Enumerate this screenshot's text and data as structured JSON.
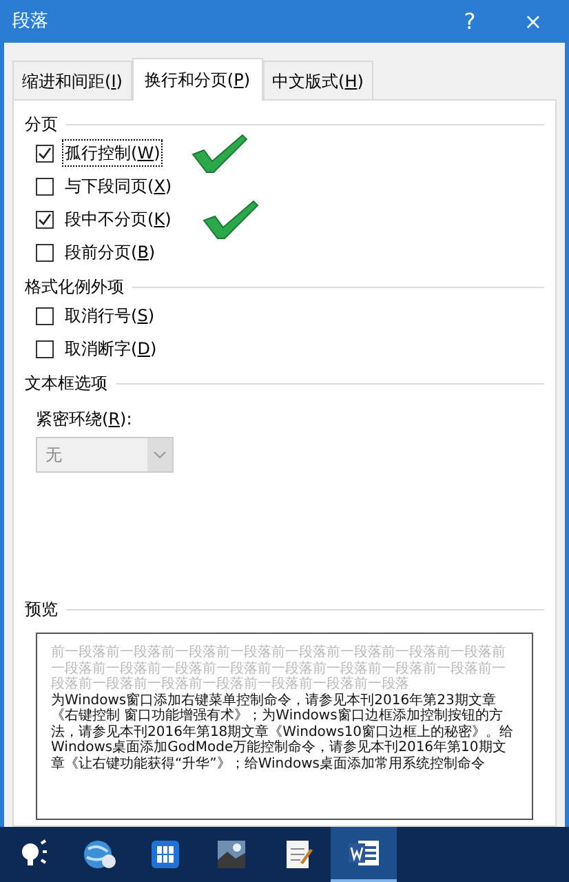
{
  "window": {
    "title": "段落",
    "help": "?",
    "close": "×"
  },
  "tabs": [
    {
      "label": "缩进和间距(I)",
      "selected": false
    },
    {
      "label": "换行和分页(P)",
      "selected": true
    },
    {
      "label": "中文版式(H)",
      "selected": false
    }
  ],
  "groups": [
    {
      "title": "分页",
      "options": [
        {
          "label": "孤行控制(W)",
          "checked": true,
          "focused": true,
          "annotated": true
        },
        {
          "label": "与下段同页(X)",
          "checked": false,
          "focused": false,
          "annotated": false
        },
        {
          "label": "段中不分页(K)",
          "checked": true,
          "focused": false,
          "annotated": true
        },
        {
          "label": "段前分页(B)",
          "checked": false,
          "focused": false,
          "annotated": false
        }
      ]
    },
    {
      "title": "格式化例外项",
      "options": [
        {
          "label": "取消行号(S)",
          "checked": false,
          "focused": false,
          "annotated": false
        },
        {
          "label": "取消断字(D)",
          "checked": false,
          "focused": false,
          "annotated": false
        }
      ]
    }
  ],
  "textbox_options": {
    "title": "文本框选项",
    "label": "紧密环绕(R):",
    "value": "无",
    "disabled": true
  },
  "preview": {
    "title": "预览",
    "previous_text": "前一段落前一段落前一段落前一段落前一段落前一段落前一段落前一段落前一段落前一段落前一段落前一段落前一段落前一段落前一段落前一段落前一段落前一段落前一段落前一段落前一段落前一段落前一段落",
    "text": "为Windows窗口添加右键菜单控制命令，请参见本刊2016年第23期文章《右键控制 窗口功能增强有术》；为Windows窗口边框添加控制按钮的方法，请参见本刊2016年第18期文章《Windows10窗口边框上的秘密》。给Windows桌面添加GodMode万能控制命令，请参见本刊2016年第10期文章《让右键功能获得“升华”》；给Windows桌面添加常用系统控制命令"
  },
  "taskbar": {
    "apps": [
      {
        "kind": "bulb",
        "selected": false
      },
      {
        "kind": "globe",
        "selected": false
      },
      {
        "kind": "tiles",
        "selected": false
      },
      {
        "kind": "photo",
        "selected": false
      },
      {
        "kind": "notepad",
        "selected": false
      },
      {
        "kind": "word",
        "selected": true
      }
    ]
  }
}
